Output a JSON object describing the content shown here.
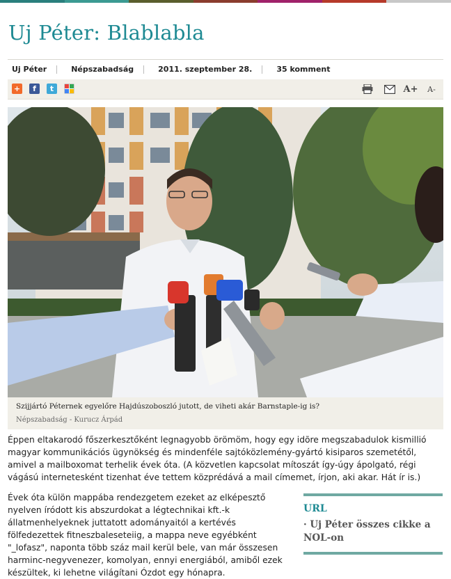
{
  "article": {
    "title": "Uj Péter: Blablabla",
    "meta": [
      "Uj Péter",
      "Népszabadság",
      "2011. szeptember 28.",
      "35 komment"
    ]
  },
  "share_icons": [
    "addthis-icon",
    "facebook-icon",
    "twitter-icon",
    "google-icon"
  ],
  "tools": [
    "print-icon",
    "email-icon",
    "font-increase-icon",
    "font-decrease-icon"
  ],
  "tool_labels": {
    "increase": "A+",
    "decrease": "A-"
  },
  "photo": {
    "caption": "Szijjártó Péternek egyelőre Hajdúszoboszló jutott, de viheti akár Barnstaple-ig is?",
    "credit": "Népszabadság - Kurucz Árpád"
  },
  "body": {
    "para1": "Éppen eltakarodó főszerkesztőként legnagyobb örömöm, hogy egy idõre megszabadulok kismillió magyar kommunikációs ügynökség és mindenféle sajtóközlemény-gyártó kisiparos szemetétől, amivel a mailboxomat terhelik évek óta. (A közvetlen kapcsolat mítoszát így-úgy ápolgató, régi vágású internetesként tizenhat éve tettem közprédává a mail címemet, írjon, aki akar. Hát ír is.)",
    "para2": "Évek óta külön mappába rendezgetem ezeket az elképesztő nyelven íródott kis abszurdokat a légtechnikai kft.-k állatmenhelyeknek juttatott adományaitól a kertévés fölfedezettek fitneszbaleseteiig, a mappa neve egyébként \"_lofasz\", naponta több száz mail kerül bele, van már összesen harminc-negyvenezer, komolyan, ennyi energiából, amiből ezek készültek, ki lehetne világítani Ózdot egy hónapra."
  },
  "sidebar": {
    "heading": "URL",
    "link": "· Uj Péter összes cikke a NOL-on"
  },
  "colors": {
    "title": "#1e8a93",
    "accent": "#6fa9a2",
    "caption_bg": "#f1efe8"
  }
}
